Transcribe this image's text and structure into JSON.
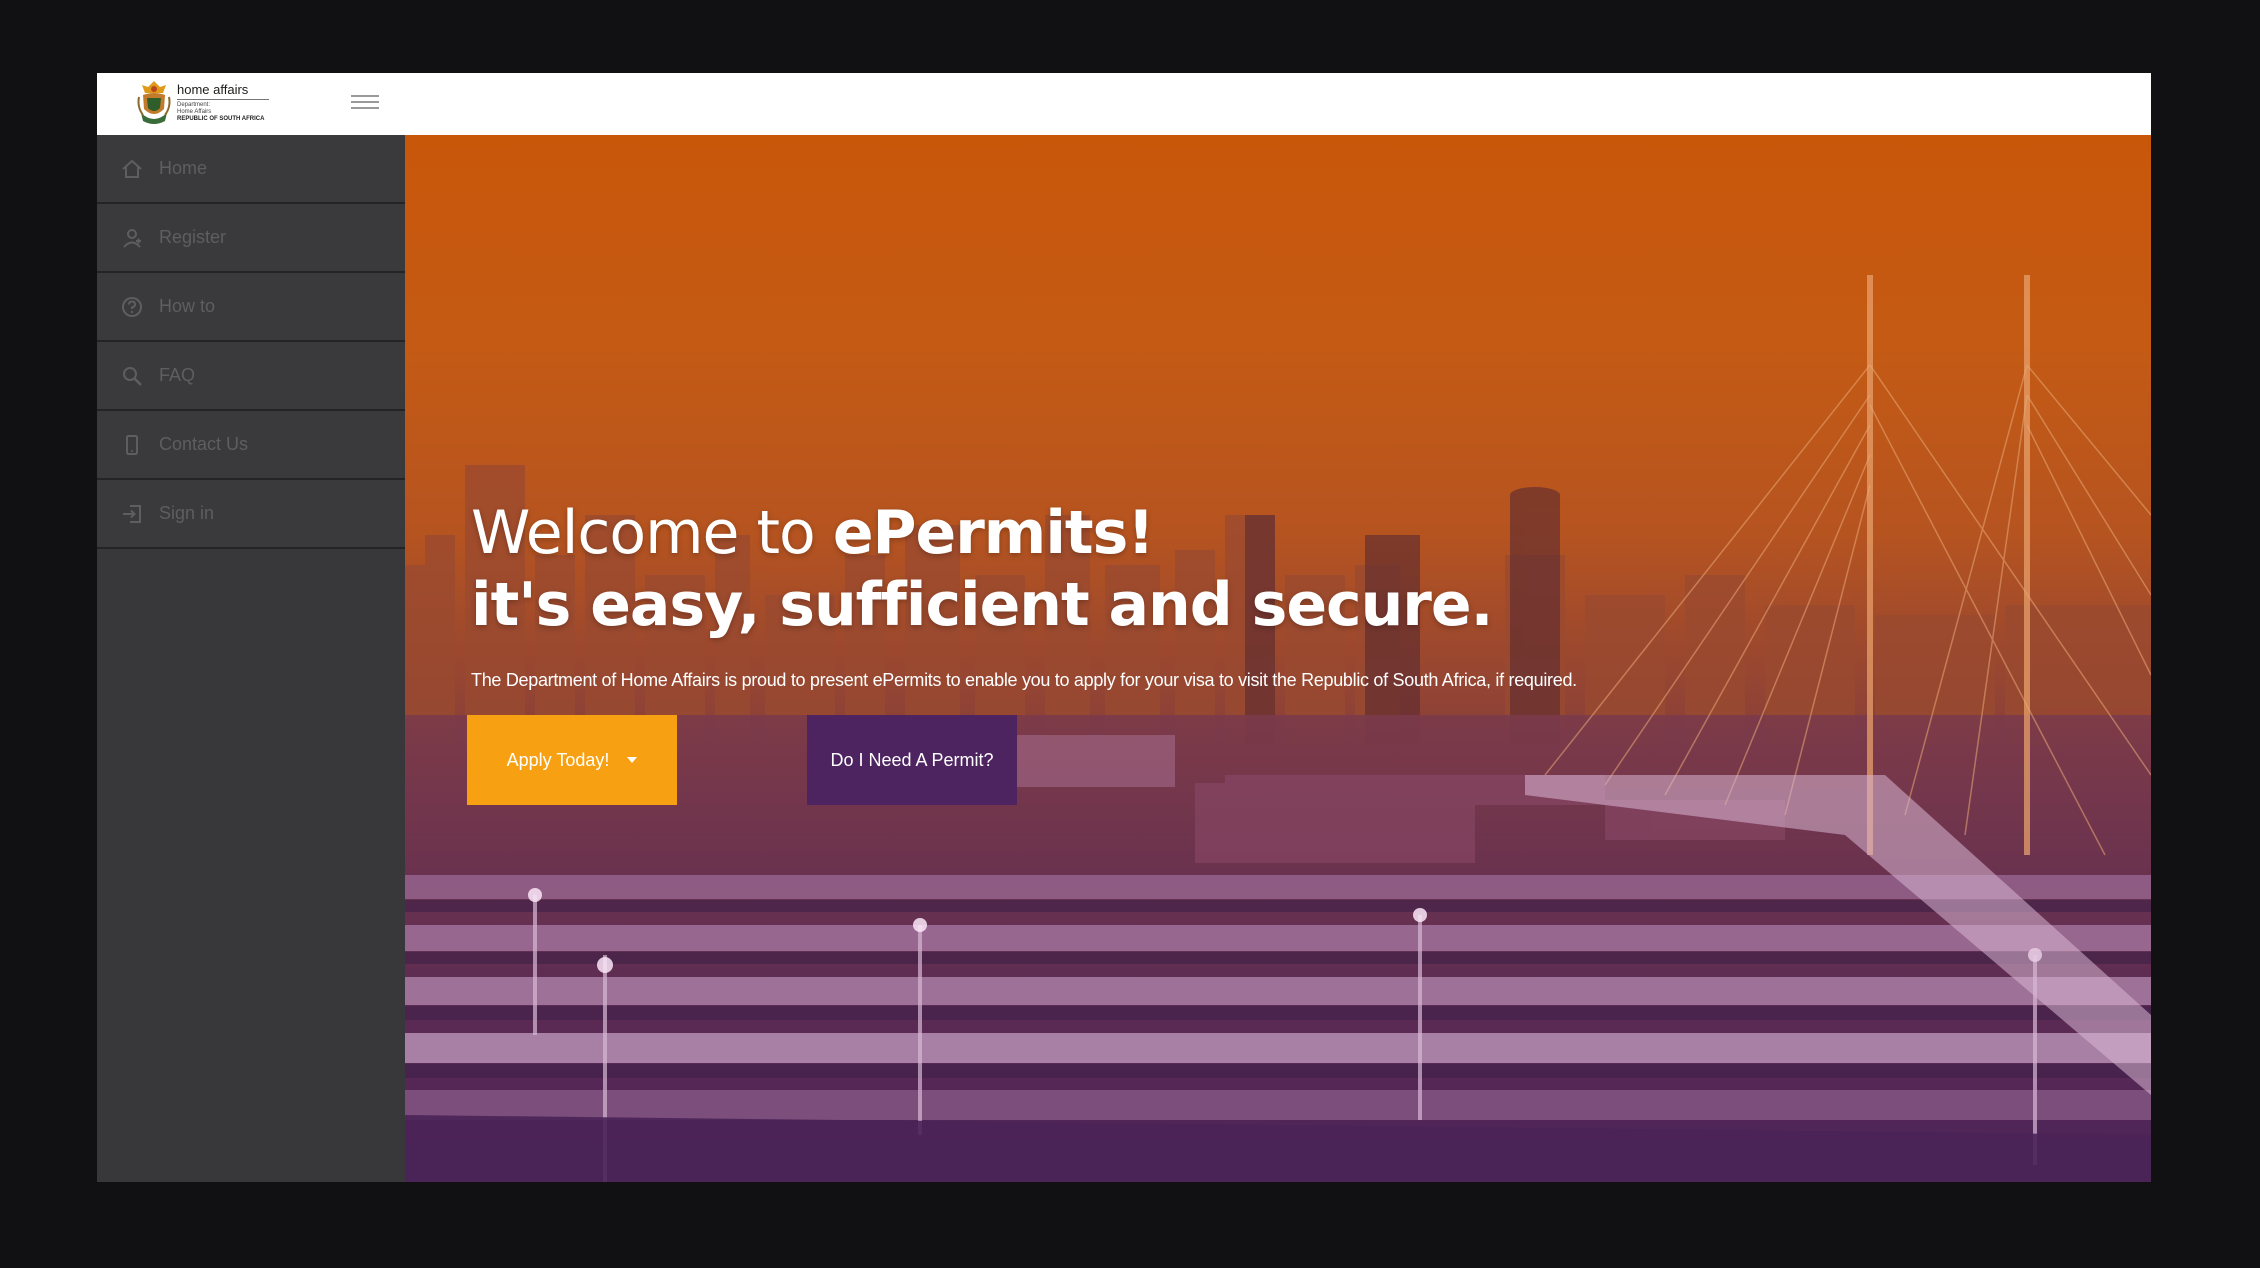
{
  "header": {
    "logo_line1": "home affairs",
    "logo_line2": "Department:",
    "logo_line3": "Home Affairs",
    "logo_line4": "REPUBLIC OF SOUTH AFRICA"
  },
  "sidebar": {
    "items": [
      {
        "label": "Home",
        "icon": "home-icon"
      },
      {
        "label": "Register",
        "icon": "register-icon"
      },
      {
        "label": "How to",
        "icon": "help-circle-icon"
      },
      {
        "label": "FAQ",
        "icon": "search-icon"
      },
      {
        "label": "Contact Us",
        "icon": "phone-icon"
      },
      {
        "label": "Sign in",
        "icon": "sign-in-icon"
      }
    ]
  },
  "hero": {
    "title_light": "Welcome to ",
    "title_bold": "ePermits!",
    "title_line2": "it's easy, sufficient and secure.",
    "subtitle": "The Department of Home Affairs is proud to present ePermits to enable you to apply for your visa to visit the Republic of South Africa, if required.",
    "apply_label": "Apply Today!",
    "permit_label": "Do I Need A Permit?"
  },
  "colors": {
    "accent_orange": "#f6a012",
    "accent_purple": "#4d2360",
    "sidebar_bg": "#3a3a3c",
    "hero_top": "#c9570a",
    "hero_bottom": "#4e2459"
  }
}
